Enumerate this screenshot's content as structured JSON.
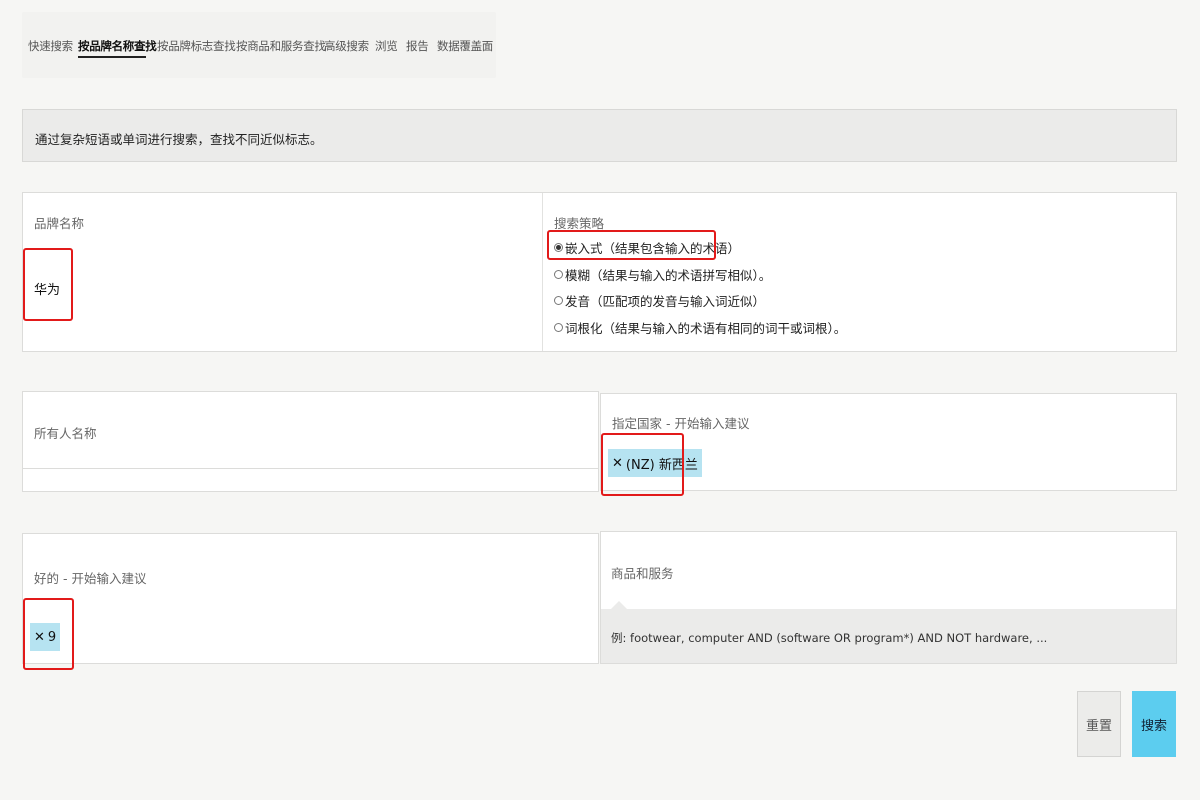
{
  "nav": {
    "items": [
      {
        "label": "快速搜索"
      },
      {
        "label": "按品牌名称查找"
      },
      {
        "label": "按品牌标志查找"
      },
      {
        "label": "按商品和服务查找"
      },
      {
        "label": "高级搜索"
      },
      {
        "label": "浏览"
      },
      {
        "label": "报告"
      },
      {
        "label": "数据覆盖面"
      }
    ],
    "active_index": 1
  },
  "info": {
    "text": "通过复杂短语或单词进行搜索，查找不同近似标志。"
  },
  "brand": {
    "label": "品牌名称",
    "value": "华为"
  },
  "strategy": {
    "label": "搜索策略",
    "options": [
      {
        "label": "嵌入式（结果包含输入的术语）",
        "selected": true
      },
      {
        "label": "模糊（结果与输入的术语拼写相似）。",
        "selected": false
      },
      {
        "label": "发音（匹配项的发音与输入词近似）",
        "selected": false
      },
      {
        "label": "词根化（结果与输入的术语有相同的词干或词根）。",
        "selected": false
      }
    ]
  },
  "owner": {
    "label": "所有人名称"
  },
  "country": {
    "label": "指定国家 - 开始输入建议",
    "chip": "(NZ) 新西兰"
  },
  "class": {
    "label": "好的 - 开始输入建议",
    "chip": "9"
  },
  "goods": {
    "label": "商品和服务",
    "hint": "例: footwear, computer AND (software OR program*) AND NOT hardware, ..."
  },
  "buttons": {
    "reset": "重置",
    "search": "搜索"
  },
  "colors": {
    "highlight": "#e21a1a",
    "chip": "#b6e3f1",
    "search_button": "#5ccdef"
  }
}
